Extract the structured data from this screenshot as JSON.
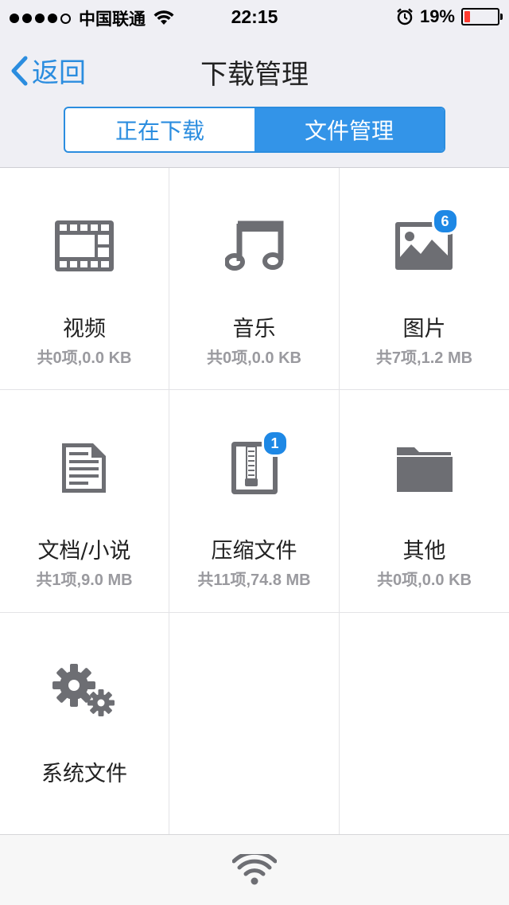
{
  "status_bar": {
    "carrier": "中国联通",
    "time": "22:15",
    "battery": "19%"
  },
  "nav": {
    "back_label": "返回",
    "title": "下载管理"
  },
  "segments": [
    {
      "label": "正在下载",
      "active": false
    },
    {
      "label": "文件管理",
      "active": true
    }
  ],
  "categories": [
    {
      "name": "视频",
      "summary": "共0项,0.0 KB",
      "icon": "film-icon"
    },
    {
      "name": "音乐",
      "summary": "共0项,0.0 KB",
      "icon": "music-note-icon"
    },
    {
      "name": "图片",
      "summary": "共7项,1.2 MB",
      "icon": "picture-icon",
      "badge": "6"
    },
    {
      "name": "文档/小说",
      "summary": "共1项,9.0 MB",
      "icon": "document-icon"
    },
    {
      "name": "压缩文件",
      "summary": "共11项,74.8 MB",
      "icon": "zip-archive-icon",
      "badge": "1"
    },
    {
      "name": "其他",
      "summary": "共0项,0.0 KB",
      "icon": "folder-icon"
    },
    {
      "name": "系统文件",
      "summary": "",
      "icon": "gears-icon"
    }
  ],
  "colors": {
    "accent": "#2b8ddf",
    "icon_gray": "#6d6e73",
    "badge": "#1e88e5"
  }
}
